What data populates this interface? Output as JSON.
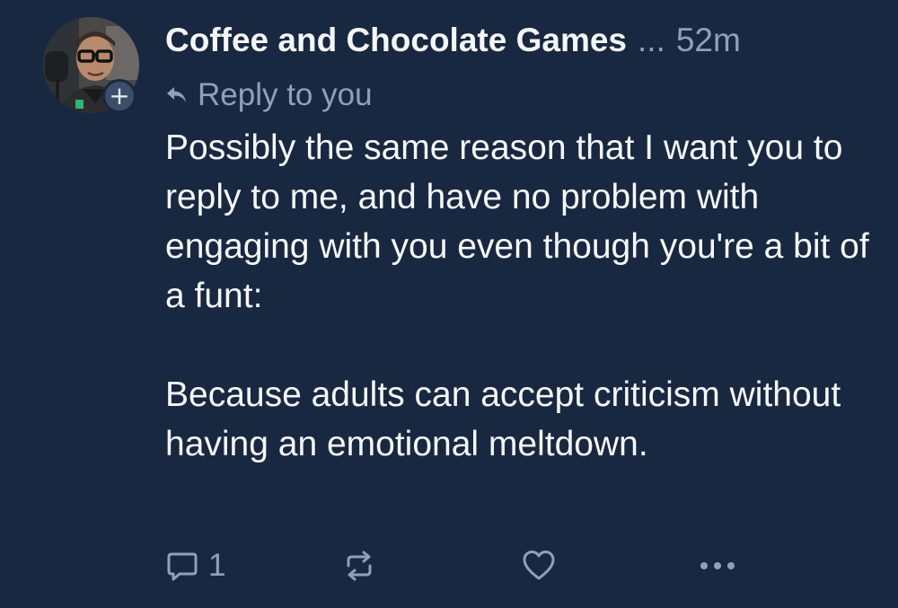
{
  "post": {
    "author": {
      "display_name": "Coffee and Chocolate Games",
      "truncation": "...",
      "avatar_icon": "user-avatar-photo",
      "follow_badge": "+"
    },
    "timestamp": "52m",
    "reply_context": {
      "icon": "reply-arrow-icon",
      "label": "Reply to you"
    },
    "body": {
      "paragraphs": [
        "Possibly the same reason that I want you to reply to me, and have no problem with engaging with you even though you're a bit of a funt:",
        "Because adults can accept criticism without having an emotional meltdown."
      ]
    },
    "actions": {
      "reply": {
        "icon": "comment-icon",
        "count": "1"
      },
      "repost": {
        "icon": "repost-icon"
      },
      "like": {
        "icon": "heart-icon"
      },
      "more": {
        "icon": "more-icon"
      }
    }
  },
  "colors": {
    "background": "#182840",
    "text_primary": "#f5f7fa",
    "text_muted": "#8ea1b8",
    "badge_background": "#3b4f6b"
  }
}
